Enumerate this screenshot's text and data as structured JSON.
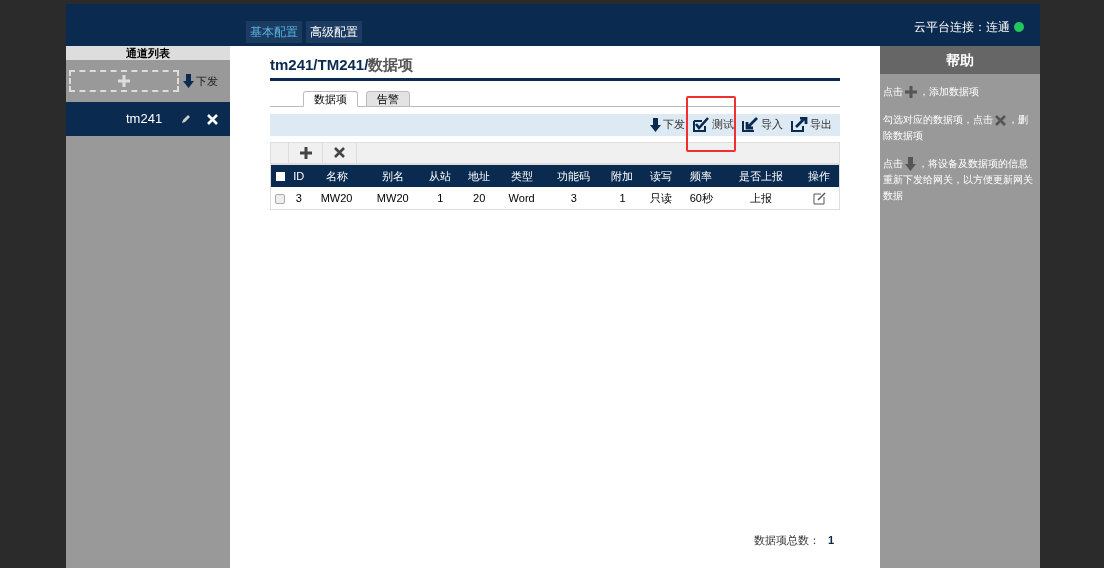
{
  "top_tabs": [
    {
      "label": "基本配置",
      "selected": true
    },
    {
      "label": "高级配置",
      "selected": false
    }
  ],
  "cloud": {
    "label": "云平台连接：连通",
    "color": "#22c55e"
  },
  "sidebar": {
    "title": "通道列表",
    "push": "下发",
    "items": [
      {
        "label": "tm241",
        "selected": true
      }
    ]
  },
  "breadcrumb": {
    "path": "tm241/TM241/",
    "current": "数据项"
  },
  "tabs": [
    {
      "label": "数据项",
      "selected": true
    },
    {
      "label": "告警",
      "selected": false
    }
  ],
  "toolbar": [
    {
      "kind": "download",
      "label": "下发",
      "highlighted": false
    },
    {
      "kind": "test",
      "label": "测试",
      "highlighted": true
    },
    {
      "kind": "import",
      "label": "导入",
      "highlighted": false
    },
    {
      "kind": "export",
      "label": "导出",
      "highlighted": false
    }
  ],
  "table": {
    "all_checked": false,
    "columns": [
      "ID",
      "名称",
      "别名",
      "从站",
      "地址",
      "类型",
      "功能码",
      "附加",
      "读写",
      "频率",
      "是否上报",
      "操作"
    ],
    "rows": [
      {
        "checked": false,
        "cells": [
          "3",
          "MW20",
          "MW20",
          "1",
          "20",
          "Word",
          "3",
          "1",
          "只读",
          "60秒",
          "上报"
        ]
      }
    ]
  },
  "total": {
    "label": "数据项总数：",
    "value": "1"
  },
  "help": {
    "title": "帮助",
    "items": [
      [
        {
          "kind": "text",
          "text": "点击"
        },
        {
          "kind": "plus"
        },
        {
          "kind": "text",
          "text": "，添加数据项"
        }
      ],
      [
        {
          "kind": "text",
          "text": "勾选对应的数据项，点击"
        },
        {
          "kind": "cross"
        },
        {
          "kind": "text",
          "text": "，删除数据项"
        }
      ],
      [
        {
          "kind": "text",
          "text": "点击"
        },
        {
          "kind": "down"
        },
        {
          "kind": "text",
          "text": "，将设备及数据项的信息重新下发给网关，以方便更新网关数据"
        }
      ]
    ]
  }
}
